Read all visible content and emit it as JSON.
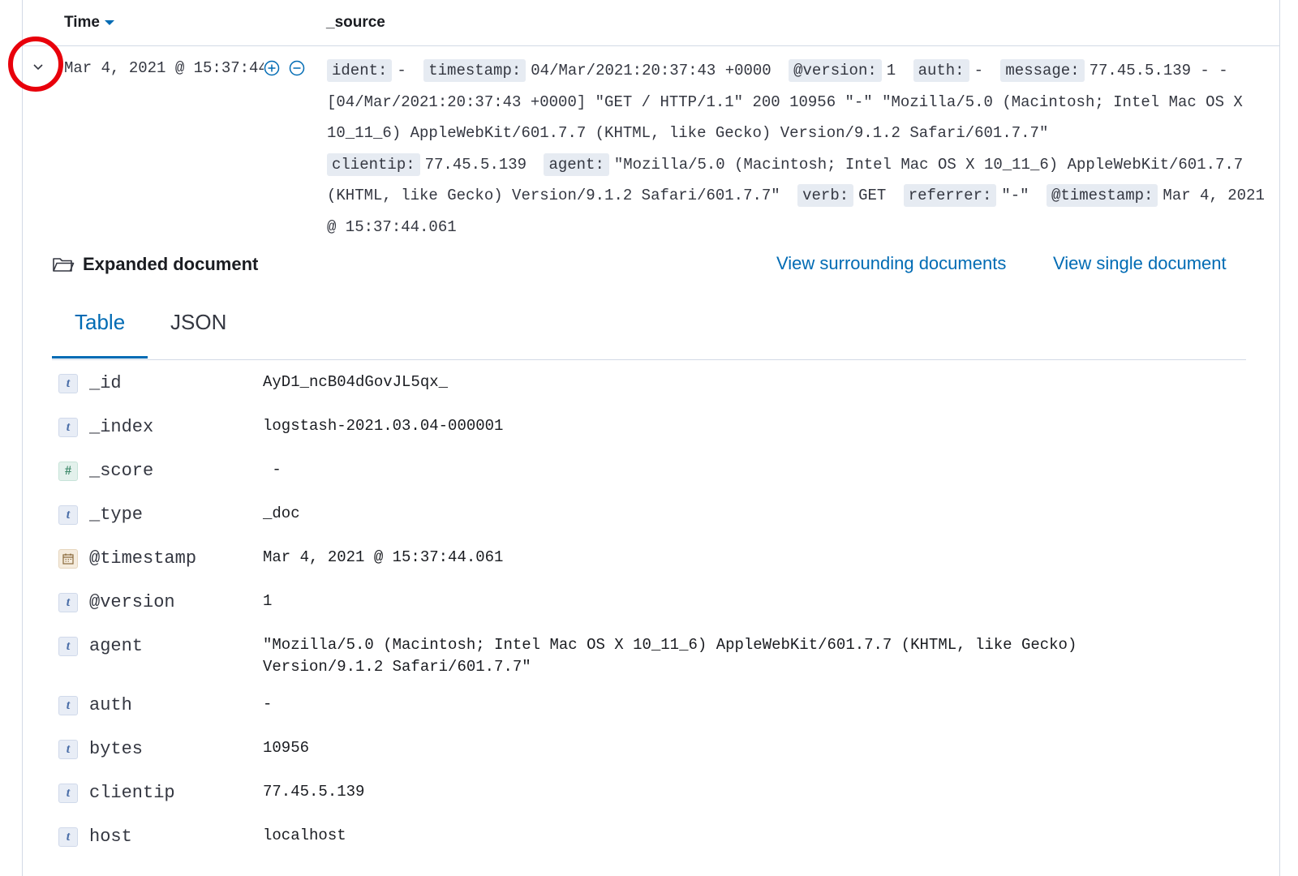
{
  "table": {
    "headers": {
      "time": "Time",
      "source": "_source"
    }
  },
  "row": {
    "time": "Mar 4, 2021 @ 15:37:44.061",
    "source_pairs": [
      {
        "key": "ident:",
        "value": "-"
      },
      {
        "key": "timestamp:",
        "value": "04/Mar/2021:20:37:43 +0000"
      },
      {
        "key": "@version:",
        "value": "1"
      },
      {
        "key": "auth:",
        "value": "-"
      },
      {
        "key": "message:",
        "value": "77.45.5.139 - - [04/Mar/2021:20:37:43 +0000] \"GET / HTTP/1.1\" 200 10956 \"-\" \"Mozilla/5.0 (Macintosh; Intel Mac OS X 10_11_6) AppleWebKit/601.7.7 (KHTML, like Gecko) Version/9.1.2 Safari/601.7.7\""
      },
      {
        "key": "clientip:",
        "value": "77.45.5.139"
      },
      {
        "key": "agent:",
        "value": "\"Mozilla/5.0 (Macintosh; Intel Mac OS X 10_11_6) AppleWebKit/601.7.7 (KHTML, like Gecko) Version/9.1.2 Safari/601.7.7\""
      },
      {
        "key": "verb:",
        "value": "GET"
      },
      {
        "key": "referrer:",
        "value": "\"-\""
      },
      {
        "key": "@timestamp:",
        "value": "Mar 4, 2021 @ 15:37:44.061"
      }
    ]
  },
  "expanded": {
    "title": "Expanded document",
    "links": {
      "surrounding": "View surrounding documents",
      "single": "View single document"
    },
    "tabs": {
      "table": "Table",
      "json": "JSON"
    },
    "fields": [
      {
        "type_icon": "t",
        "name": "_id",
        "value": "AyD1_ncB04dGovJL5qx_"
      },
      {
        "type_icon": "t",
        "name": "_index",
        "value": "logstash-2021.03.04-000001"
      },
      {
        "type_icon": "#",
        "name": "_score",
        "value": " -"
      },
      {
        "type_icon": "t",
        "name": "_type",
        "value": "_doc"
      },
      {
        "type_icon": "date",
        "name": "@timestamp",
        "value": "Mar 4, 2021 @ 15:37:44.061"
      },
      {
        "type_icon": "t",
        "name": "@version",
        "value": "1"
      },
      {
        "type_icon": "t",
        "name": "agent",
        "value": "\"Mozilla/5.0 (Macintosh; Intel Mac OS X 10_11_6) AppleWebKit/601.7.7 (KHTML, like Gecko)\nVersion/9.1.2 Safari/601.7.7\""
      },
      {
        "type_icon": "t",
        "name": "auth",
        "value": "-"
      },
      {
        "type_icon": "t",
        "name": "bytes",
        "value": "10956"
      },
      {
        "type_icon": "t",
        "name": "clientip",
        "value": "77.45.5.139"
      },
      {
        "type_icon": "t",
        "name": "host",
        "value": "localhost"
      }
    ]
  },
  "colors": {
    "accent": "#006bb4",
    "highlight_ring": "#e8000b",
    "key_background": "#e6ebf2"
  }
}
